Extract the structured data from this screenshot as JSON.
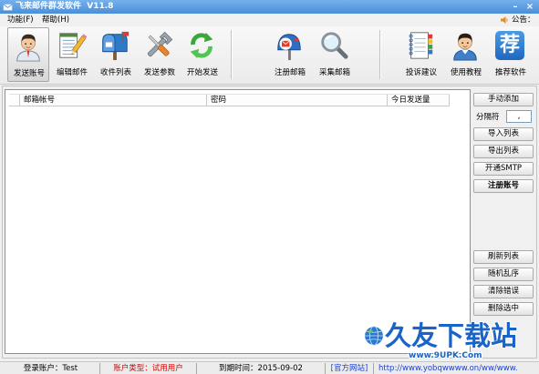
{
  "window": {
    "title": "飞来邮件群发软件  V11.8",
    "minimize_label": "–",
    "close_label": "×"
  },
  "menu": {
    "items": [
      {
        "label": "功能(F)"
      },
      {
        "label": "帮助(H)"
      }
    ],
    "notice_label": "公告："
  },
  "toolbar": {
    "items": [
      {
        "label": "发送账号",
        "icon": "user-account-icon",
        "selected": true
      },
      {
        "label": "编辑邮件",
        "icon": "edit-mail-icon"
      },
      {
        "label": "收件列表",
        "icon": "mailbox-icon"
      },
      {
        "label": "发送参数",
        "icon": "tools-icon"
      },
      {
        "label": "开始发送",
        "icon": "start-send-icon"
      },
      {
        "label": "注册邮箱",
        "icon": "register-mailbox-icon"
      },
      {
        "label": "采集邮箱",
        "icon": "magnifier-icon"
      },
      {
        "label": "投诉建议",
        "icon": "notebook-icon"
      },
      {
        "label": "使用教程",
        "icon": "tutorial-person-icon"
      },
      {
        "label": "推荐软件",
        "icon": "recommend-icon",
        "glyph": "荐"
      }
    ]
  },
  "table": {
    "columns": [
      "",
      "邮箱帐号",
      "密码",
      "今日发送量"
    ],
    "rows": []
  },
  "side_panel": {
    "manual_add": "手动添加",
    "separator_label": "分隔符",
    "separator_value": ",",
    "import": "导入列表",
    "export": "导出列表",
    "open_smtp": "开通SMTP",
    "register_account": "注册账号",
    "refresh": "刷新列表",
    "shuffle": "随机乱序",
    "clear_errors": "清除错误",
    "delete_selected": "删除选中"
  },
  "status": {
    "login": "登录账户：Test",
    "account_type": "账户类型：试用用户",
    "expiry": "到期时间：2015-09-02",
    "website": "[官方网站]",
    "url": "http://www.yobqwwww.on/ww/www."
  },
  "watermark": {
    "name": "久友下载站",
    "url": "www.9UPK.Com"
  },
  "colors": {
    "title_bar": "#4a8fd8",
    "account_type_text": "#e00000",
    "website_link": "#1a3fd0",
    "watermark_text": "#1a64c8"
  }
}
